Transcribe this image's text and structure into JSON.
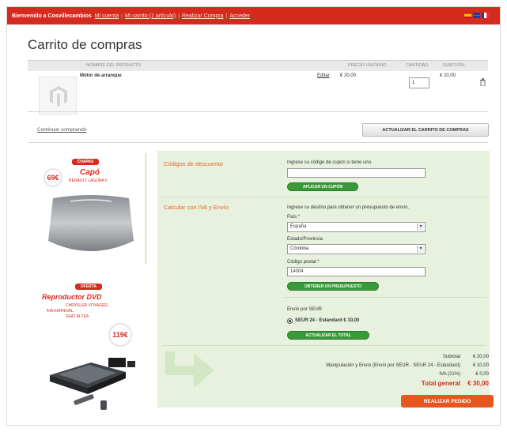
{
  "topbar": {
    "welcome": "Bienvenido a Cosvillecambios",
    "links": [
      "Mi cuenta",
      "Mi carrito (1 artículo)",
      "Realizar Compra",
      "Acceder"
    ]
  },
  "page_title": "Carrito de compras",
  "table": {
    "headers": {
      "product": "NOMBRE DEL PRODUCTO",
      "unit_price": "PRECIO UNITARIO",
      "qty": "CANTIDAD",
      "subtotal": "SUBTOTAL"
    },
    "row": {
      "name": "Motor de arranque",
      "edit": "Editar",
      "unit_price": "€ 20,00",
      "qty": "1",
      "subtotal": "€ 20,00"
    }
  },
  "continue_label": "Continuar comprando",
  "update_cart_label": "ACTUALIZAR EL CARRITO DE COMPRAS",
  "promo1": {
    "badge": "CHAPAS",
    "price": "69€",
    "title": "Capó",
    "subtitle": "RENAULT LAGUNA II"
  },
  "promo2": {
    "badge": "OFERTA",
    "title": "Reproductor DVD",
    "lines": [
      "CHRYSLER VOYAGER,",
      "KIA KARNIVAL,",
      "SEAT ALTEA"
    ],
    "price": "119€"
  },
  "discount": {
    "title": "Códigos de descuento",
    "prompt": "Ingrese su código de cupón si tiene uno.",
    "value": "",
    "button": "APLICAR UN CUPÓN"
  },
  "shipping": {
    "title": "Calcular con IVA y Envío",
    "prompt": "Ingrese su destino para obtener un presupuesto de envío.",
    "country_label": "País *",
    "country_value": "España",
    "region_label": "Estado/Provincia",
    "region_value": "Córdoba",
    "zip_label": "Código postal *",
    "zip_value": "14004",
    "quote_button": "OBTENER UN PRESUPUESTO",
    "method_title": "Envío por SEUR",
    "method_option": "SEUR 24 - Estandard € 10,00",
    "update_total_button": "ACTUALIZAR EL TOTAL"
  },
  "totals": {
    "subtotal_label": "Subtotal",
    "subtotal_value": "€ 20,00",
    "shipping_label": "Manipulación y Envío (Envío por SEUR - SEUR 24 - Estandard)",
    "shipping_value": "€ 10,00",
    "tax_label": "IVA (21%)",
    "tax_value": "€ 0,00",
    "grand_label": "Total general",
    "grand_value": "€ 30,00"
  },
  "checkout_label": "REALIZAR PEDIDO",
  "colors": {
    "brand_red": "#d52b1e",
    "panel_green": "#e7f1de",
    "button_green": "#3a9a39",
    "checkout_orange": "#e8561f",
    "section_orange": "#e06b2a"
  }
}
